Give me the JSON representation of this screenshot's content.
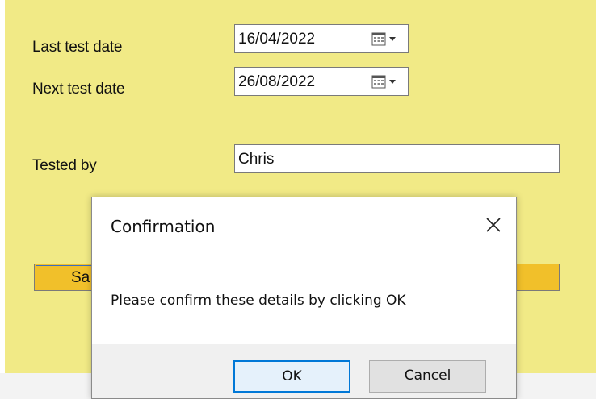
{
  "form": {
    "last_test_label": "Last test date",
    "last_test_value": "16/04/2022",
    "next_test_label": "Next test date",
    "next_test_value": "26/08/2022",
    "tested_by_label": "Tested by",
    "tested_by_value": "Chris",
    "save_label": "Sa"
  },
  "dialog": {
    "title": "Confirmation",
    "message": "Please confirm these details by clicking OK",
    "ok_label": "OK",
    "cancel_label": "Cancel"
  },
  "colors": {
    "form_background": "#f1ea86",
    "button_yellow": "#f1c02a",
    "ok_border": "#0078d7"
  },
  "icons": [
    "calendar-dropdown-icon",
    "close-icon"
  ]
}
